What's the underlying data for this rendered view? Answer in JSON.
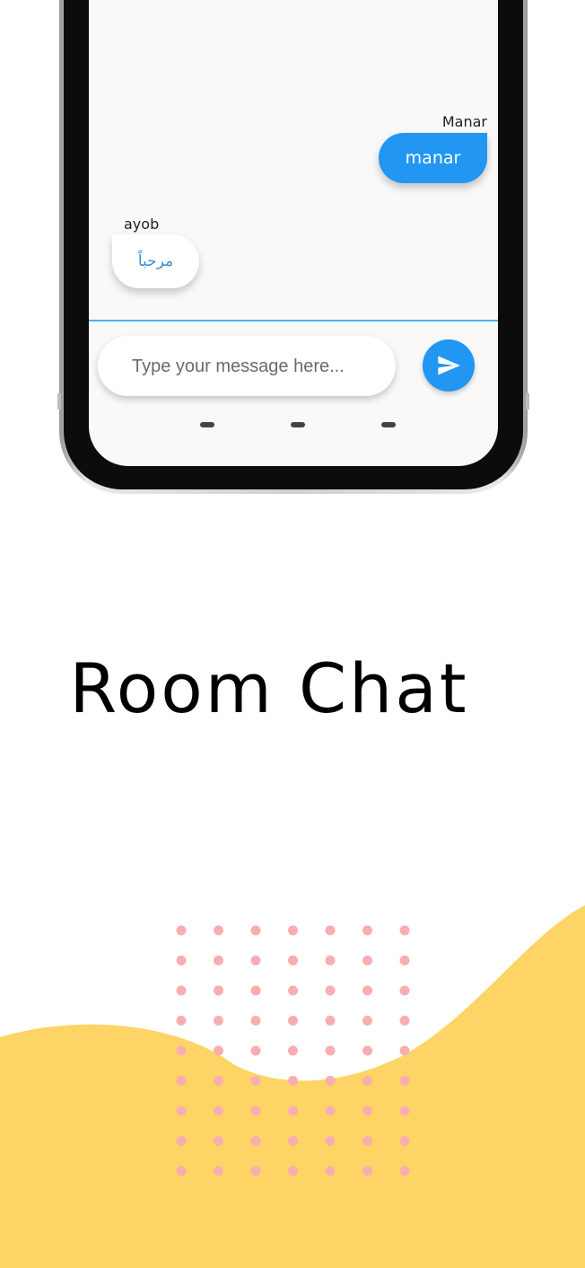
{
  "chat": {
    "messages": [
      {
        "sender": "Manar",
        "text": "manar",
        "is_mine": true
      },
      {
        "sender": "ayob",
        "text": "مرحباً",
        "is_mine": false
      }
    ],
    "input": {
      "placeholder": "Type your message here...",
      "value": ""
    }
  },
  "headline": {
    "title": "Room Chat"
  },
  "colors": {
    "accent": "#2196f3",
    "divider": "#46b2f0",
    "wave": "#fdd465",
    "dots": "#f8aeb1",
    "incoming_text": "#3d8fd0"
  },
  "icons": {
    "send": "send-icon"
  }
}
